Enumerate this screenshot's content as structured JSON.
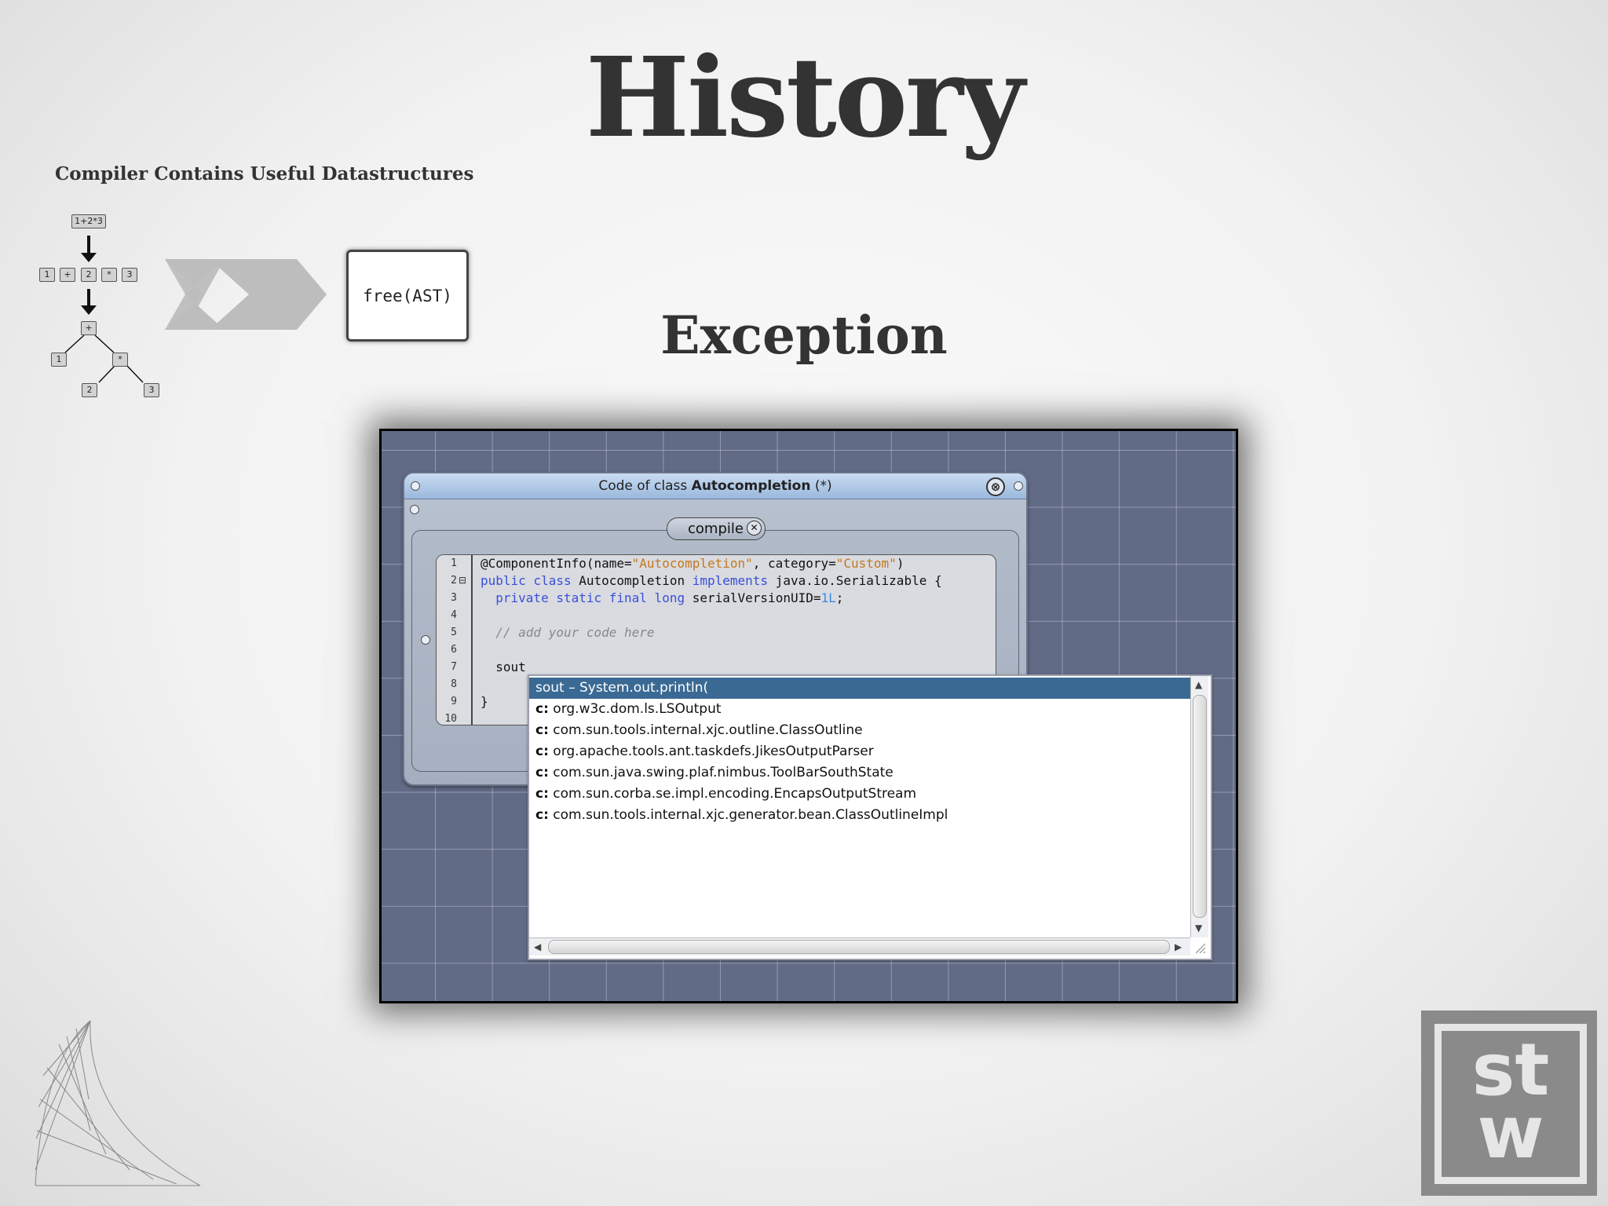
{
  "slide": {
    "title": "History",
    "subtitle": "Compiler Contains Useful Datastructures",
    "section_heading": "Exception"
  },
  "diagram": {
    "expression": "1+2*3",
    "tokens": [
      "1",
      "+",
      "2",
      "*",
      "3"
    ],
    "tree": {
      "root": "+",
      "left": "1",
      "right_op": "*",
      "right_left": "2",
      "right_right": "3"
    },
    "free_label": "free(AST)"
  },
  "window": {
    "title_prefix": "Code of class ",
    "title_class": "Autocompletion",
    "title_suffix": " (*)",
    "close_glyph": "⊗",
    "compile_label": "compile",
    "compile_close_glyph": "✕"
  },
  "editor": {
    "line_numbers": [
      "1",
      "2",
      "3",
      "4",
      "5",
      "6",
      "7",
      "8",
      "9",
      "10"
    ],
    "fold_marker": "⊟",
    "lines": {
      "l1_a": "@ComponentInfo(name=",
      "l1_b": "\"Autocompletion\"",
      "l1_c": ", category=",
      "l1_d": "\"Custom\"",
      "l1_e": ")",
      "l2_a": "public class",
      "l2_b": " Autocompletion ",
      "l2_c": "implements",
      "l2_d": " java.io.Serializable {",
      "l3_a": "  private static final long",
      "l3_b": " serialVersionUID=",
      "l3_c": "1L",
      "l3_d": ";",
      "l5": "  // add your code here",
      "l7": "  sout",
      "l9": "}"
    }
  },
  "autocomplete": {
    "items": [
      {
        "prefix": "",
        "text": "sout – System.out.println(",
        "selected": true
      },
      {
        "prefix": "c:",
        "text": " org.w3c.dom.ls.LSOutput",
        "selected": false
      },
      {
        "prefix": "c:",
        "text": " com.sun.tools.internal.xjc.outline.ClassOutline",
        "selected": false
      },
      {
        "prefix": "c:",
        "text": " org.apache.tools.ant.taskdefs.JikesOutputParser",
        "selected": false
      },
      {
        "prefix": "c:",
        "text": " com.sun.java.swing.plaf.nimbus.ToolBarSouthState",
        "selected": false
      },
      {
        "prefix": "c:",
        "text": " com.sun.corba.se.impl.encoding.EncapsOutputStream",
        "selected": false
      },
      {
        "prefix": "c:",
        "text": " com.sun.tools.internal.xjc.generator.bean.ClassOutlineImpl",
        "selected": false
      }
    ],
    "scroll_up": "▲",
    "scroll_down": "▼",
    "scroll_left": "◀",
    "scroll_right": "▶"
  },
  "logo": {
    "top_text": "st",
    "bottom_text": "w"
  }
}
